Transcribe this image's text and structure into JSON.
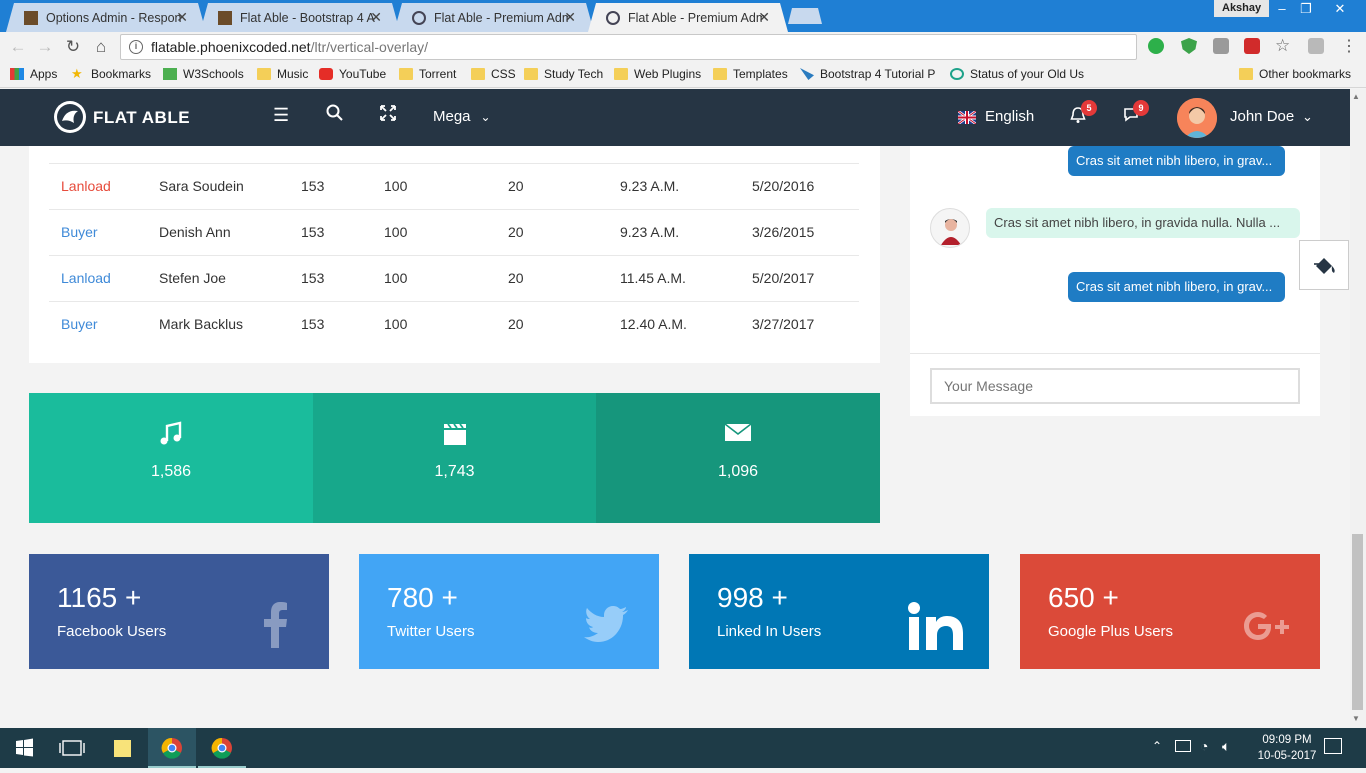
{
  "browser": {
    "tabs": [
      {
        "title": "Options Admin - Respon",
        "active": false
      },
      {
        "title": "Flat Able - Bootstrap 4 A",
        "active": false
      },
      {
        "title": "Flat Able - Premium Adm",
        "active": false
      },
      {
        "title": "Flat Able - Premium Adm",
        "active": true
      }
    ],
    "profile_name": "Akshay",
    "url_host": "flatable.phoenixcoded.net",
    "url_path": "/ltr/vertical-overlay/"
  },
  "bookmarks": [
    {
      "label": "Apps",
      "icon": "apps-grid-icon"
    },
    {
      "label": "Bookmarks",
      "icon": "star-icon"
    },
    {
      "label": "W3Schools",
      "icon": "w3schools-icon"
    },
    {
      "label": "Music",
      "icon": "folder-icon"
    },
    {
      "label": "YouTube",
      "icon": "youtube-icon"
    },
    {
      "label": "Torrent",
      "icon": "folder-icon"
    },
    {
      "label": "CSS",
      "icon": "folder-icon"
    },
    {
      "label": "Study Tech",
      "icon": "folder-icon"
    },
    {
      "label": "Web Plugins",
      "icon": "folder-icon"
    },
    {
      "label": "Templates",
      "icon": "folder-icon"
    },
    {
      "label": "Bootstrap 4 Tutorial P",
      "icon": "bootstrap-icon"
    },
    {
      "label": "Status of your Old Us",
      "icon": "status-icon"
    }
  ],
  "other_bookmarks": "Other bookmarks",
  "header": {
    "brand": "FLAT ABLE",
    "mega_label": "Mega",
    "language": "English",
    "notification_count": "5",
    "message_count": "9",
    "user_name": "John Doe"
  },
  "table": {
    "rows": [
      {
        "type": "Lanload",
        "type_color": "#e74c3c",
        "name": "Sara Soudein",
        "c1": "153",
        "c2": "100",
        "c3": "20",
        "time": "9.23 A.M.",
        "date": "5/20/2016"
      },
      {
        "type": "Buyer",
        "type_color": "#3f8ad8",
        "name": "Denish Ann",
        "c1": "153",
        "c2": "100",
        "c3": "20",
        "time": "9.23 A.M.",
        "date": "3/26/2015"
      },
      {
        "type": "Lanload",
        "type_color": "#3f8ad8",
        "name": "Stefen Joe",
        "c1": "153",
        "c2": "100",
        "c3": "20",
        "time": "11.45 A.M.",
        "date": "5/20/2017"
      },
      {
        "type": "Buyer",
        "type_color": "#3f8ad8",
        "name": "Mark Backlus",
        "c1": "153",
        "c2": "100",
        "c3": "20",
        "time": "12.40 A.M.",
        "date": "3/27/2017"
      }
    ]
  },
  "media_stats": [
    {
      "icon": "music-icon",
      "value": "1,586",
      "color": "#1abc9c"
    },
    {
      "icon": "film-icon",
      "value": "1,743",
      "color": "#17a88b"
    },
    {
      "icon": "mail-icon",
      "value": "1,096",
      "color": "#16967c"
    }
  ],
  "chat": {
    "messages": [
      {
        "direction": "out",
        "text": "Cras sit amet nibh libero, in grav..."
      },
      {
        "direction": "in",
        "text": "Cras sit amet nibh libero, in gravida nulla. Nulla ..."
      },
      {
        "direction": "out",
        "text": "Cras sit amet nibh libero, in grav..."
      }
    ],
    "input_placeholder": "Your Message"
  },
  "social": [
    {
      "value": "1165 +",
      "label": "Facebook Users",
      "color": "#3b5998",
      "icon": "facebook-icon"
    },
    {
      "value": "780 +",
      "label": "Twitter Users",
      "color": "#42a5f5",
      "icon": "twitter-icon"
    },
    {
      "value": "998 +",
      "label": "Linked In Users",
      "color": "#0077b5",
      "icon": "linkedin-icon"
    },
    {
      "value": "650 +",
      "label": "Google Plus Users",
      "color": "#db4a39",
      "icon": "google-plus-icon"
    }
  ],
  "taskbar": {
    "time": "09:09 PM",
    "date": "10-05-2017"
  }
}
